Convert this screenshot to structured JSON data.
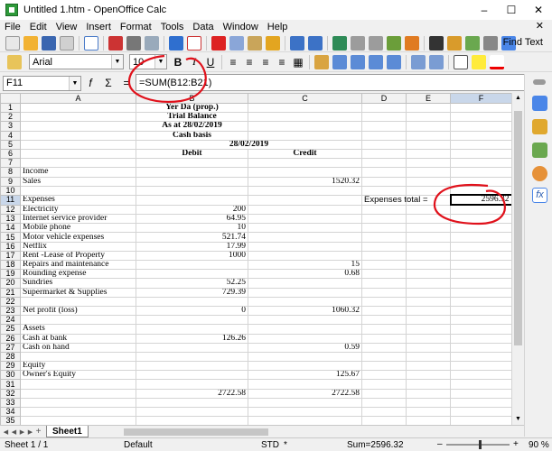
{
  "window": {
    "title": "Untitled 1.htm - OpenOffice Calc"
  },
  "menu": [
    "File",
    "Edit",
    "View",
    "Insert",
    "Format",
    "Tools",
    "Data",
    "Window",
    "Help"
  ],
  "toolbar": {
    "find_text": "Find Text"
  },
  "formatting": {
    "font_name": "Arial",
    "font_size": "10",
    "bold": "B",
    "italic": "I",
    "underline": "U"
  },
  "formula_bar": {
    "cell_ref": "F11",
    "formula": "=SUM(B12:B21)"
  },
  "columns": [
    "A",
    "B",
    "C",
    "D",
    "E",
    "F"
  ],
  "sheet": {
    "r1": "Yer Da (prop.)",
    "r2": "Trial Balance",
    "r3": "As at 28/02/2019",
    "r4": "Cash basis",
    "r5": "28/02/2019",
    "r6b": "Debit",
    "r6c": "Credit",
    "r8": "Income",
    "r9": "Sales",
    "r9c": "1520.32",
    "r11": "Expenses",
    "r11d": "Expenses total =",
    "r11f": "2596.32",
    "r12": "Electricity",
    "r12b": "200",
    "r13": "Internet service provider",
    "r13b": "64.95",
    "r14": "Mobile phone",
    "r14b": "10",
    "r15": "Motor vehicle expenses",
    "r15b": "521.74",
    "r16": "Netflix",
    "r16b": "17.99",
    "r17": "Rent -Lease of Property",
    "r17b": "1000",
    "r18": "Repairs and maintenance",
    "r18c": "15",
    "r19": "Rounding expense",
    "r19c": "0.68",
    "r20": "Sundries",
    "r20b": "52.25",
    "r21": "Supermarket & Supplies",
    "r21b": "729.39",
    "r23": "Net profit (loss)",
    "r23b": "0",
    "r23c": "1060.32",
    "r25": "Assets",
    "r26": "Cash at bank",
    "r26b": "126.26",
    "r27": "Cash on hand",
    "r27c": "0.59",
    "r29": "Equity",
    "r30": "Owner's Equity",
    "r30c": "125.67",
    "r32b": "2722.58",
    "r32c": "2722.58"
  },
  "tabs": {
    "sheet1": "Sheet1"
  },
  "status": {
    "sheet_pos": "Sheet 1 / 1",
    "style": "Default",
    "mode": "STD",
    "star": "*",
    "sum": "Sum=2596.32",
    "zoom": "90 %"
  },
  "colors": {
    "annotation_red": "#e0111b",
    "selection_highlight": "#c9d7ea"
  }
}
